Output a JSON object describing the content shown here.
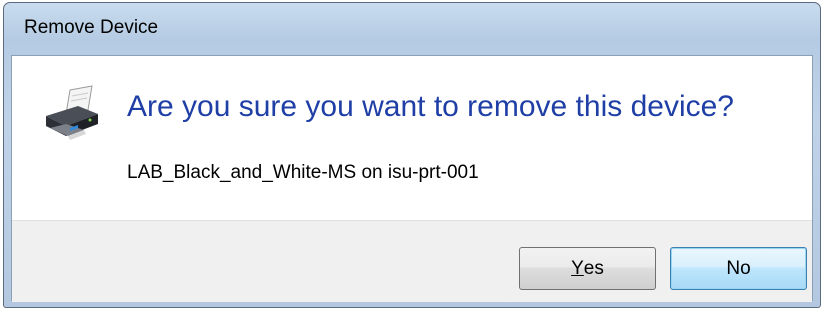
{
  "window": {
    "title": "Remove Device"
  },
  "dialog": {
    "icon": "printer-icon",
    "main_instruction": "Are you sure you want to remove this device?",
    "device_name": "LAB_Black_and_White-MS on isu-prt-001"
  },
  "buttons": {
    "yes": {
      "accelerator": "Y",
      "rest": "es"
    },
    "no": {
      "label": "No"
    }
  },
  "colors": {
    "instruction_text": "#1f3fa6",
    "titlebar": "#bfd2e8",
    "footer": "#f0f0f0"
  }
}
